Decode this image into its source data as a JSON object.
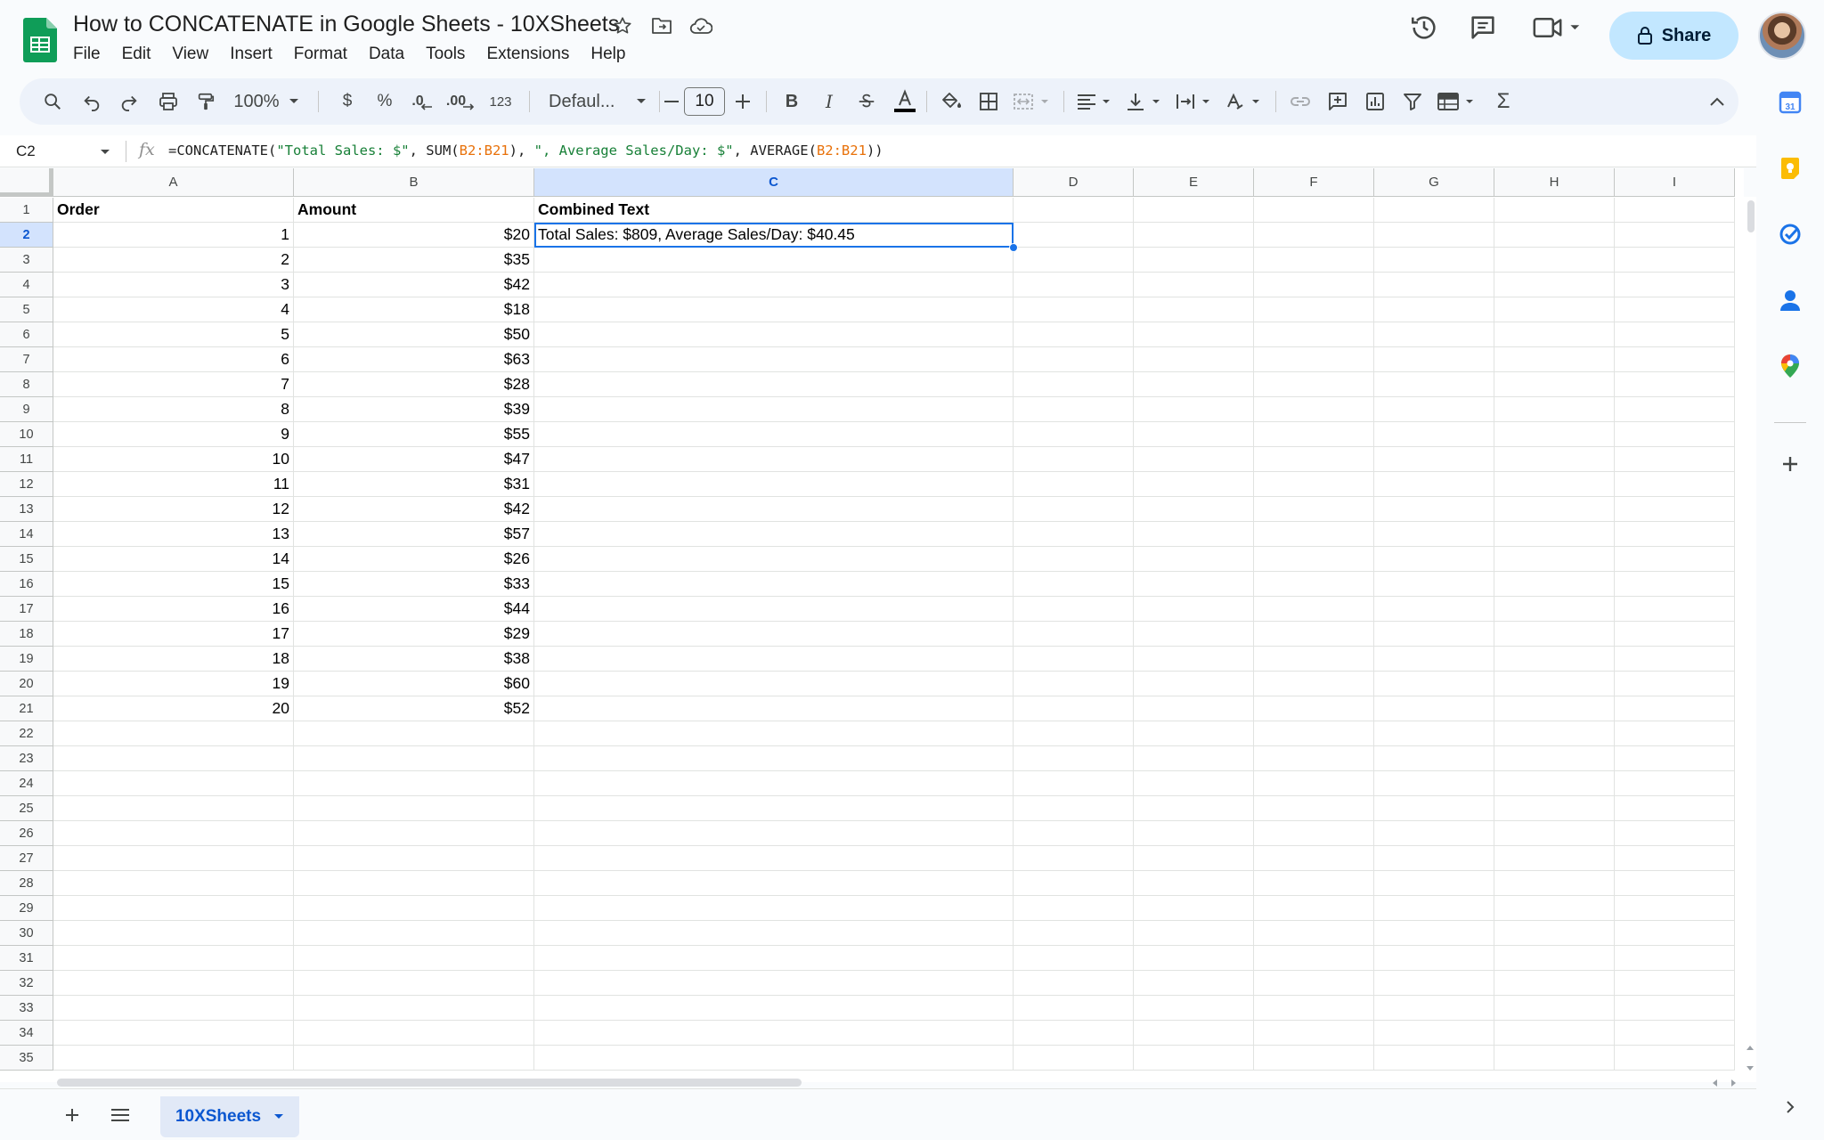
{
  "document": {
    "title": "How to CONCATENATE in Google Sheets - 10XSheets",
    "share_label": "Share"
  },
  "menu": [
    "File",
    "Edit",
    "View",
    "Insert",
    "Format",
    "Data",
    "Tools",
    "Extensions",
    "Help"
  ],
  "toolbar": {
    "zoom": "100%",
    "currency": "$",
    "percent": "%",
    "decrease_decimal": ".0",
    "increase_decimal": ".00",
    "number_format": "123",
    "font": "Defaul...",
    "font_size": "10",
    "bold": "B",
    "italic": "I",
    "sum": "Σ"
  },
  "formula_bar": {
    "name_box": "C2",
    "fx": "fx",
    "formula": {
      "p1": "=CONCATENATE(",
      "s1": "\"Total Sales: $\"",
      "p2": ", SUM(",
      "r1": "B2:B21",
      "p3": "), ",
      "s2": "\", Average Sales/Day: $\"",
      "p4": ", AVERAGE(",
      "r2": "B2:B21",
      "p5": "))"
    }
  },
  "grid": {
    "columns": [
      "A",
      "B",
      "C",
      "D",
      "E",
      "F",
      "G",
      "H",
      "I"
    ],
    "selected_column": "C",
    "selected_row": 2,
    "row_numbers": [
      1,
      2,
      3,
      4,
      5,
      6,
      7,
      8,
      9,
      10,
      11,
      12,
      13,
      14,
      15,
      16,
      17,
      18,
      19,
      20,
      21,
      22,
      23,
      24,
      25,
      26,
      27,
      28,
      29,
      30,
      31,
      32,
      33,
      34,
      35
    ],
    "headers": {
      "A1": "Order",
      "B1": "Amount",
      "C1": "Combined Text"
    },
    "rows": [
      {
        "order": "1",
        "amount": "$20"
      },
      {
        "order": "2",
        "amount": "$35"
      },
      {
        "order": "3",
        "amount": "$42"
      },
      {
        "order": "4",
        "amount": "$18"
      },
      {
        "order": "5",
        "amount": "$50"
      },
      {
        "order": "6",
        "amount": "$63"
      },
      {
        "order": "7",
        "amount": "$28"
      },
      {
        "order": "8",
        "amount": "$39"
      },
      {
        "order": "9",
        "amount": "$55"
      },
      {
        "order": "10",
        "amount": "$47"
      },
      {
        "order": "11",
        "amount": "$31"
      },
      {
        "order": "12",
        "amount": "$42"
      },
      {
        "order": "13",
        "amount": "$57"
      },
      {
        "order": "14",
        "amount": "$26"
      },
      {
        "order": "15",
        "amount": "$33"
      },
      {
        "order": "16",
        "amount": "$44"
      },
      {
        "order": "17",
        "amount": "$29"
      },
      {
        "order": "18",
        "amount": "$38"
      },
      {
        "order": "19",
        "amount": "$60"
      },
      {
        "order": "20",
        "amount": "$52"
      }
    ],
    "C2": "Total Sales: $809, Average Sales/Day: $40.45"
  },
  "sheets": [
    {
      "name": "10XSheets",
      "active": true
    }
  ],
  "colors": {
    "accent": "#1a73e8",
    "share_bg": "#c2e7ff",
    "selected_header": "#d3e3fd",
    "formula_string": "#188038",
    "formula_range": "#e8710a"
  }
}
